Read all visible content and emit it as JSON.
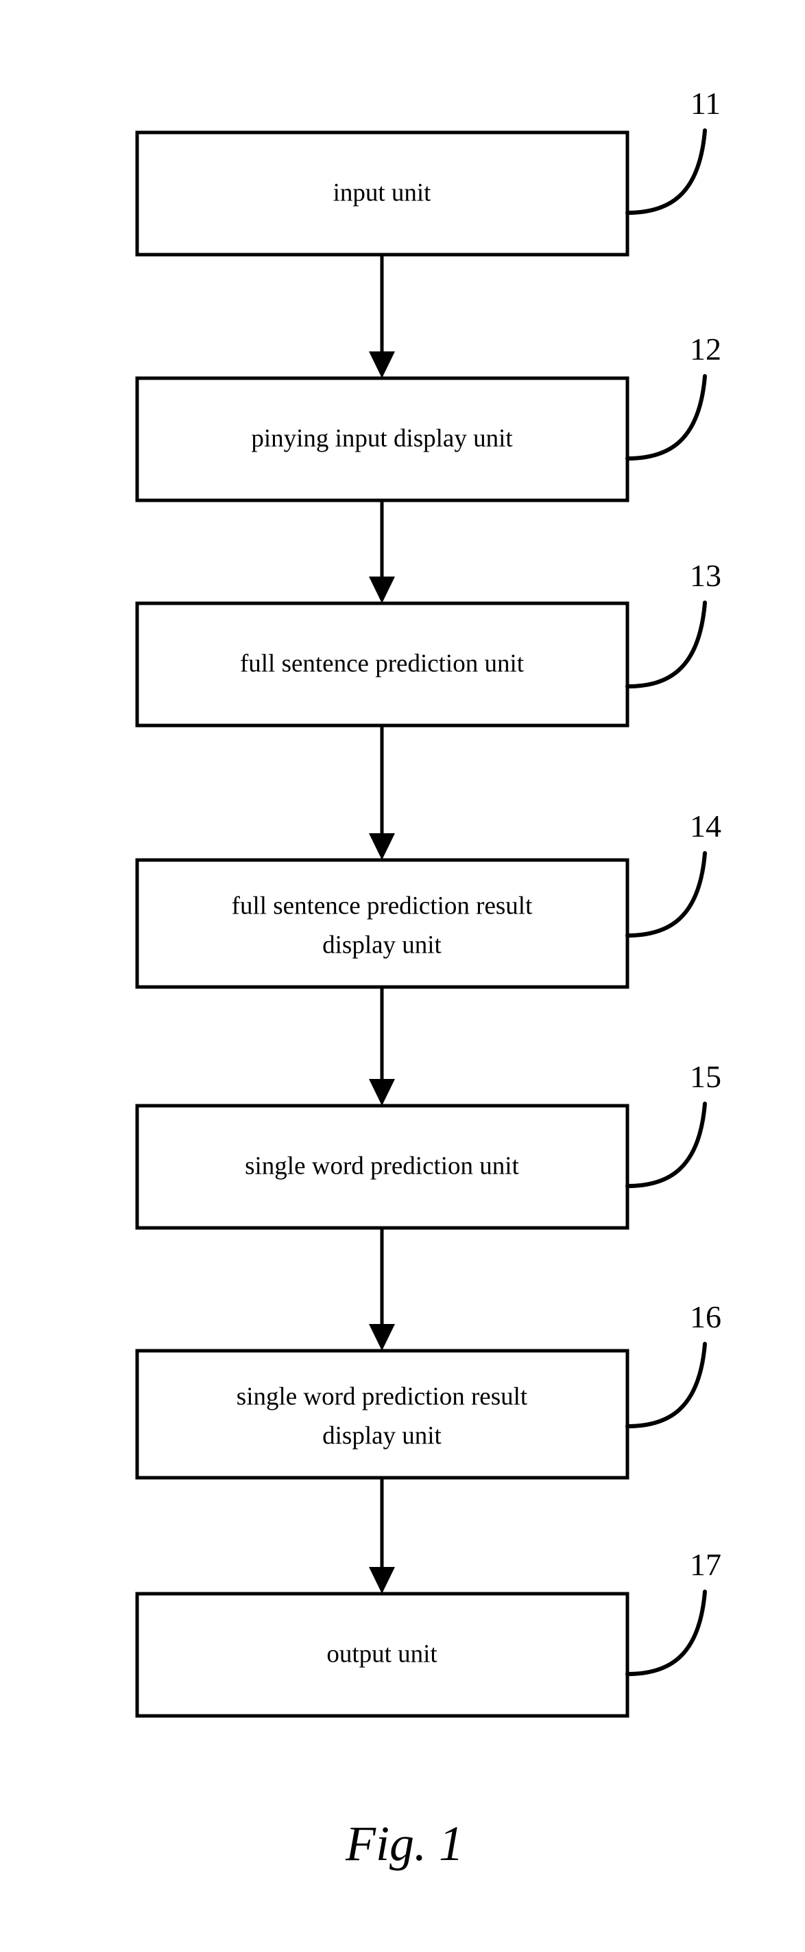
{
  "figure": {
    "caption": "Fig. 1",
    "type": "block-flow-diagram",
    "orientation": "vertical",
    "background_color": "#ffffff",
    "line_color": "#000000",
    "box_fill_color": "#ffffff"
  },
  "blocks": [
    {
      "ref": "11",
      "lines": [
        "input unit"
      ],
      "line1": "input unit",
      "line2": ""
    },
    {
      "ref": "12",
      "lines": [
        "pinying input display unit"
      ],
      "line1": "pinying input display unit",
      "line2": ""
    },
    {
      "ref": "13",
      "lines": [
        "full sentence prediction unit"
      ],
      "line1": "full sentence prediction unit",
      "line2": ""
    },
    {
      "ref": "14",
      "lines": [
        "full sentence prediction result",
        "display unit"
      ],
      "line1": "full sentence prediction result",
      "line2": "display unit"
    },
    {
      "ref": "15",
      "lines": [
        "single word prediction unit"
      ],
      "line1": "single word prediction unit",
      "line2": ""
    },
    {
      "ref": "16",
      "lines": [
        "single word prediction result",
        "display unit"
      ],
      "line1": "single word prediction result",
      "line2": "display unit"
    },
    {
      "ref": "17",
      "lines": [
        "output unit"
      ],
      "line1": "output unit",
      "line2": ""
    }
  ],
  "connectors": [
    {
      "from_ref": "11",
      "to_ref": "12",
      "kind": "arrow-down"
    },
    {
      "from_ref": "12",
      "to_ref": "13",
      "kind": "arrow-down"
    },
    {
      "from_ref": "13",
      "to_ref": "14",
      "kind": "arrow-down"
    },
    {
      "from_ref": "14",
      "to_ref": "15",
      "kind": "arrow-down"
    },
    {
      "from_ref": "15",
      "to_ref": "16",
      "kind": "arrow-down"
    },
    {
      "from_ref": "16",
      "to_ref": "17",
      "kind": "arrow-down"
    }
  ]
}
